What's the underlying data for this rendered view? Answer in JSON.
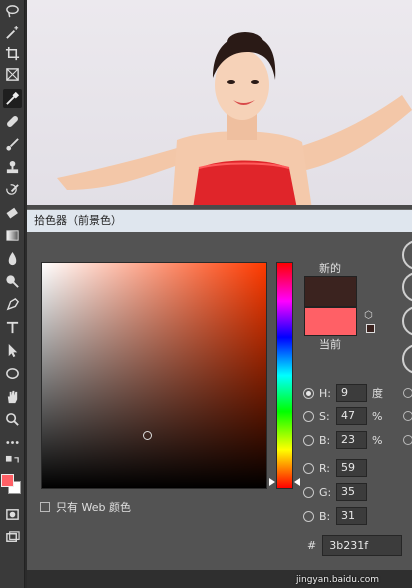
{
  "dialog": {
    "title": "拾色器（前景色）",
    "label_new": "新的",
    "label_current": "当前",
    "new_color": "#3b231f",
    "current_color": "#ff6066",
    "web_only_label": "只有 Web 颜色",
    "fields": [
      {
        "label": "H:",
        "value": "9",
        "unit": "度",
        "selected": true
      },
      {
        "label": "S:",
        "value": "47",
        "unit": "%",
        "selected": false
      },
      {
        "label": "B:",
        "value": "23",
        "unit": "%",
        "selected": false
      },
      {
        "label": "R:",
        "value": "59",
        "unit": "",
        "selected": false
      },
      {
        "label": "G:",
        "value": "35",
        "unit": "",
        "selected": false
      },
      {
        "label": "B:",
        "value": "31",
        "unit": "",
        "selected": false
      }
    ],
    "hex_label": "#",
    "hex_value": "3b231f"
  },
  "toolbar": {
    "tools": [
      "lasso-icon",
      "magic-wand-icon",
      "crop-icon",
      "frame-icon",
      "eyedropper-icon",
      "healing-brush-icon",
      "brush-icon",
      "stamp-icon",
      "history-brush-icon",
      "eraser-icon",
      "gradient-icon",
      "blur-icon",
      "dodge-icon",
      "pen-icon",
      "type-icon",
      "path-selection-icon",
      "ellipse-icon",
      "hand-icon",
      "zoom-icon",
      "more-icon"
    ],
    "foreground_color": "#ff6066",
    "background_color": "#ffffff"
  },
  "watermark": "jingyan.baidu.com"
}
